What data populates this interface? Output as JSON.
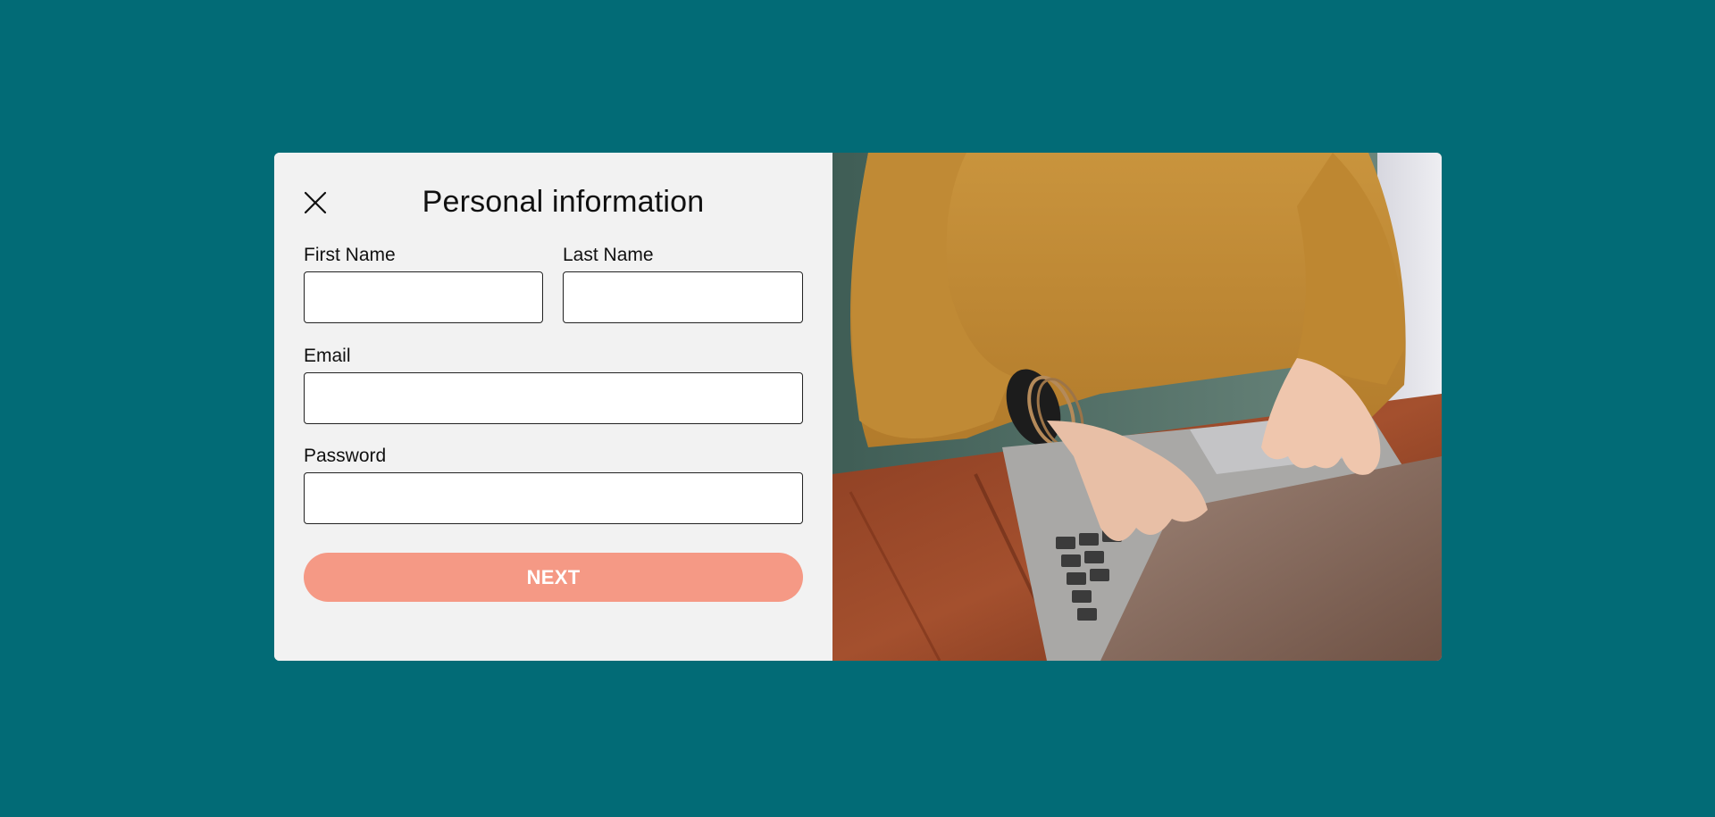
{
  "form": {
    "title": "Personal information",
    "first_name": {
      "label": "First Name",
      "value": "",
      "placeholder": ""
    },
    "last_name": {
      "label": "Last Name",
      "value": "",
      "placeholder": ""
    },
    "email": {
      "label": "Email",
      "value": "",
      "placeholder": ""
    },
    "password": {
      "label": "Password",
      "value": "",
      "placeholder": ""
    },
    "next_label": "NEXT",
    "close_icon": "close-icon"
  },
  "colors": {
    "background": "#026b76",
    "panel": "#f2f2f2",
    "button": "#f59985",
    "button_text": "#ffffff"
  },
  "image": {
    "subject": "person-typing-on-laptop-photo"
  }
}
